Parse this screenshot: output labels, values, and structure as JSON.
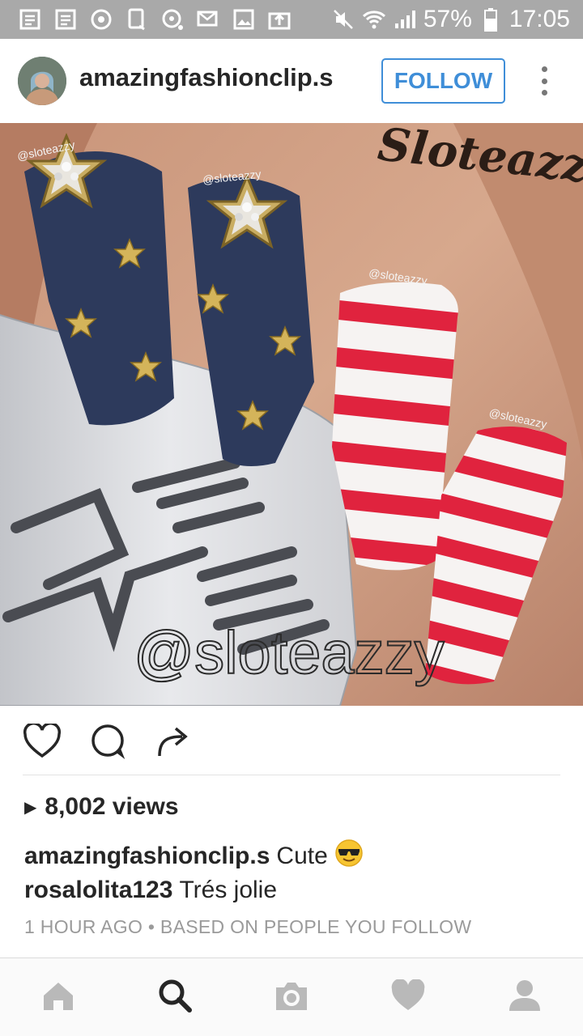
{
  "status_bar": {
    "battery_percent": "57%",
    "time": "17:05",
    "icons": [
      "notification-icon",
      "notification-icon",
      "sync-icon",
      "tablet-icon",
      "record-icon",
      "email-icon",
      "image-icon",
      "upload-icon",
      "mute-icon",
      "wifi-icon",
      "signal-icon",
      "battery-icon"
    ]
  },
  "header": {
    "username": "amazingfashionclip.s",
    "follow_label": "FOLLOW",
    "more_icon": "more-vertical-icon"
  },
  "post_image": {
    "watermark_top": "Sloteazzy",
    "watermark_main": "@sloteazzy",
    "nail_tag_1": "@sloteazzy",
    "nail_tag_2": "@sloteazzy",
    "nail_tag_3": "@sloteazzy",
    "nail_tag_4": "@sloteazzy"
  },
  "actions": {
    "like_icon": "heart-icon",
    "comment_icon": "comment-icon",
    "share_icon": "share-icon"
  },
  "views": {
    "count_text": "8,002 views"
  },
  "captions": [
    {
      "user": "amazingfashionclip.s",
      "text": "Cute",
      "emoji": "😎"
    },
    {
      "user": "rosalolita123",
      "text": "Trés jolie"
    }
  ],
  "meta": {
    "time_ago": "1 HOUR AGO",
    "separator": "•",
    "context": "BASED ON PEOPLE YOU FOLLOW"
  },
  "tabbar": {
    "items": [
      "home-icon",
      "search-icon",
      "camera-icon",
      "heart-icon",
      "profile-icon"
    ],
    "active": "search-icon"
  },
  "colors": {
    "accent": "#3f8ed8",
    "status_bar": "#a9a9a9",
    "nail_navy": "#2d3a5c",
    "nail_red": "#e0233e"
  }
}
